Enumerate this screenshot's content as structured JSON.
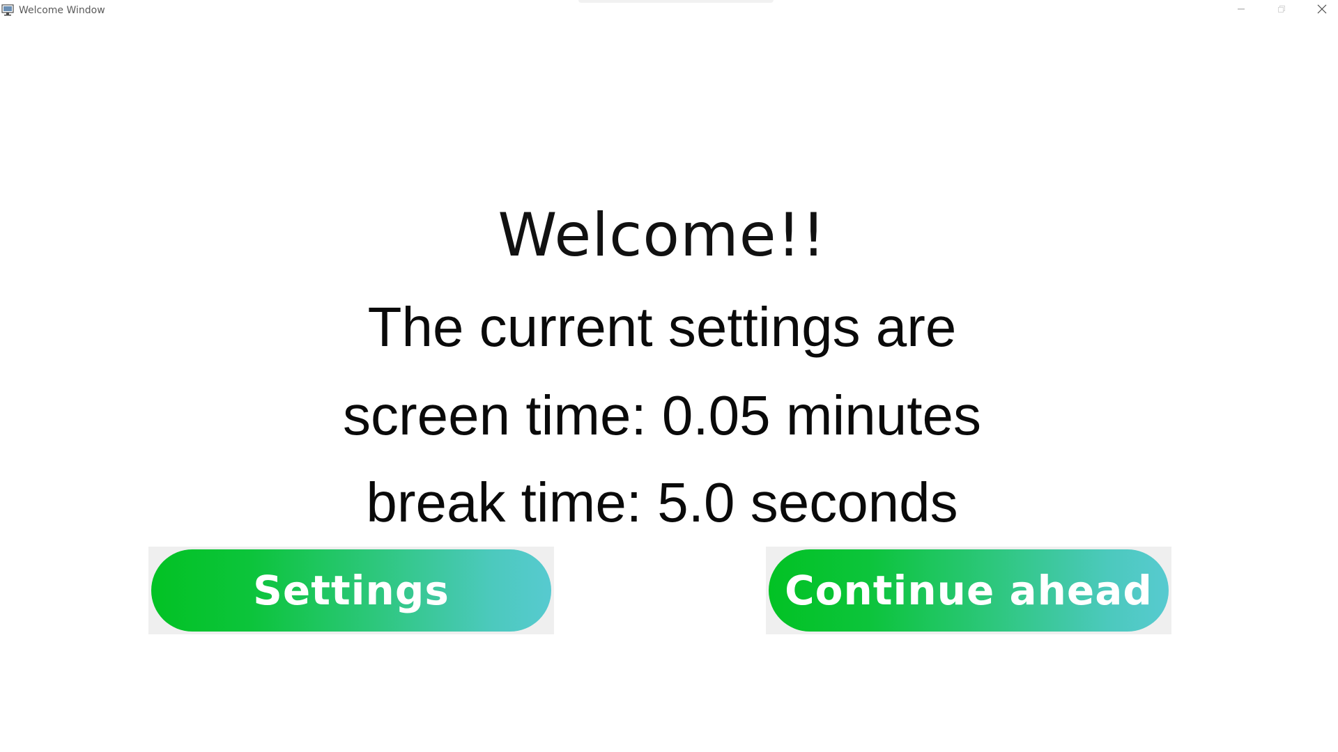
{
  "window": {
    "title": "Welcome Window",
    "controls": {
      "minimize_icon": "minimize-icon",
      "maximize_icon": "restore-icon",
      "close_icon": "close-icon"
    }
  },
  "content": {
    "heading": "Welcome!!",
    "intro": "The current settings are",
    "screen_time_line": "screen time: 0.05 minutes",
    "break_time_line": "break time: 5.0 seconds"
  },
  "buttons": {
    "settings_label": "Settings",
    "continue_label": "Continue ahead"
  },
  "colors": {
    "gradient_start": "#02c224",
    "gradient_end": "#57cad0",
    "text": "#111111",
    "button_text": "#ffffff",
    "button_frame": "#efefef"
  }
}
